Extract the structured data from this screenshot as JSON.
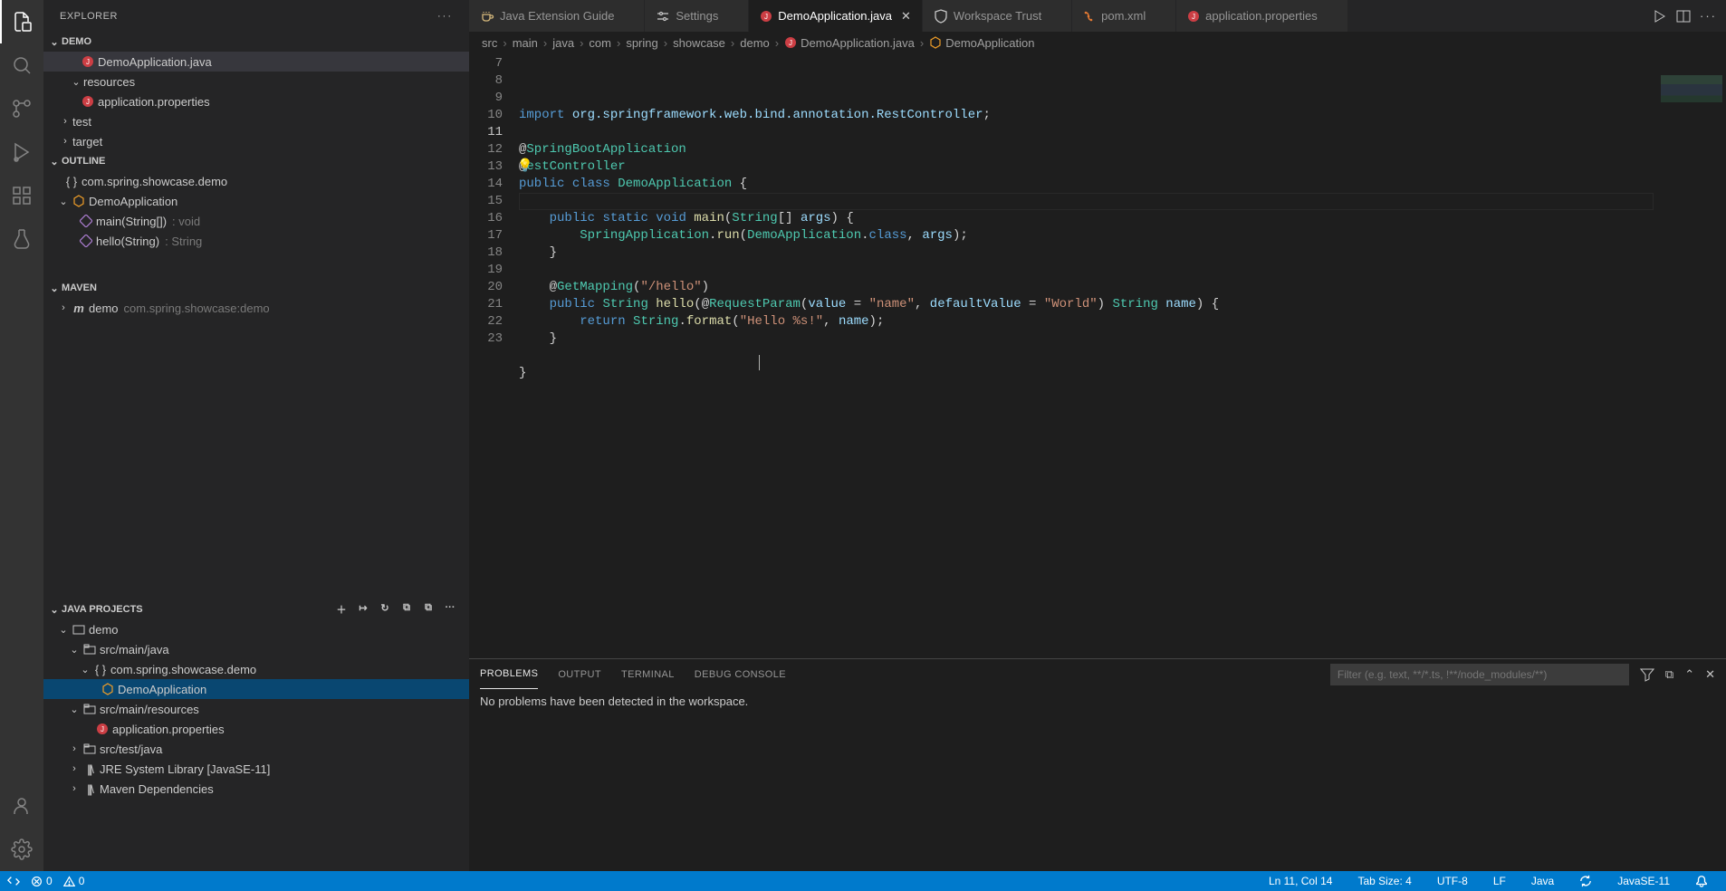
{
  "sidebar": {
    "title": "EXPLORER",
    "demo": {
      "title": "DEMO",
      "items": [
        "DemoApplication.java",
        "resources",
        "application.properties",
        "test",
        "target"
      ]
    },
    "outline": {
      "title": "OUTLINE",
      "ns": "com.spring.showcase.demo",
      "cls": "DemoApplication",
      "m1": "main(String[])",
      "m1d": ": void",
      "m2": "hello(String)",
      "m2d": ": String"
    },
    "maven": {
      "title": "MAVEN",
      "project": "demo",
      "detail": "com.spring.showcase:demo"
    },
    "javaprojects": {
      "title": "JAVA PROJECTS",
      "root": "demo",
      "srcmainjava": "src/main/java",
      "pkg": "com.spring.showcase.demo",
      "cls": "DemoApplication",
      "srcmainres": "src/main/resources",
      "appprops": "application.properties",
      "srctestjava": "src/test/java",
      "jre": "JRE System Library [JavaSE-11]",
      "mavendeps": "Maven Dependencies"
    }
  },
  "tabs": [
    {
      "label": "Java Extension Guide",
      "icon": "coffee"
    },
    {
      "label": "Settings",
      "icon": "settings"
    },
    {
      "label": "DemoApplication.java",
      "icon": "java",
      "active": true
    },
    {
      "label": "Workspace Trust",
      "icon": "shield"
    },
    {
      "label": "pom.xml",
      "icon": "xml"
    },
    {
      "label": "application.properties",
      "icon": "java"
    }
  ],
  "breadcrumb": [
    "src",
    "main",
    "java",
    "com",
    "spring",
    "showcase",
    "demo",
    "DemoApplication.java",
    "DemoApplication"
  ],
  "editor": {
    "first_line_no": 7,
    "lines": [
      {
        "no": 7,
        "html": "<span class='kw'>import</span> <span class='pkg'>org.springframework.web.bind.annotation.RestController</span>;"
      },
      {
        "no": 8,
        "html": ""
      },
      {
        "no": 9,
        "html": "<span class='pn'>@</span><span class='type'>SpringBootApplication</span>"
      },
      {
        "no": 10,
        "html": "<span class='bulb'>💡</span><span class='pn'>@</span><span class='type'>estController</span>",
        "overlay": "RestController"
      },
      {
        "no": 11,
        "html": "<span class='kw'>public</span> <span class='kw'>class</span> <span class='type'>DemoApplication</span> {",
        "active": true
      },
      {
        "no": 12,
        "html": ""
      },
      {
        "no": 13,
        "html": "    <span class='kw'>public</span> <span class='kw'>static</span> <span class='kw'>void</span> <span class='fn'>main</span>(<span class='type'>String</span>[] <span class='var'>args</span>) {"
      },
      {
        "no": 14,
        "html": "        <span class='type'>SpringApplication</span>.<span class='fn'>run</span>(<span class='type'>DemoApplication</span>.<span class='kw'>class</span>, <span class='var'>args</span>);"
      },
      {
        "no": 15,
        "html": "    }"
      },
      {
        "no": 16,
        "html": ""
      },
      {
        "no": 17,
        "html": "    <span class='pn'>@</span><span class='type'>GetMapping</span>(<span class='str'>\"/hello\"</span>)"
      },
      {
        "no": 18,
        "html": "    <span class='kw'>public</span> <span class='type'>String</span> <span class='fn'>hello</span>(<span class='pn'>@</span><span class='type'>RequestParam</span>(<span class='var'>value</span> = <span class='str'>\"name\"</span>, <span class='var'>defaultValue</span> = <span class='str'>\"World\"</span>) <span class='type'>String</span> <span class='var'>name</span>) {"
      },
      {
        "no": 19,
        "html": "        <span class='kw'>return</span> <span class='type'>String</span>.<span class='fn'>format</span>(<span class='str'>\"Hello %s!\"</span>, <span class='var'>name</span>);"
      },
      {
        "no": 20,
        "html": "    }"
      },
      {
        "no": 21,
        "html": ""
      },
      {
        "no": 22,
        "html": "}"
      },
      {
        "no": 23,
        "html": ""
      }
    ]
  },
  "panel": {
    "tabs": [
      "PROBLEMS",
      "OUTPUT",
      "TERMINAL",
      "DEBUG CONSOLE"
    ],
    "active": "PROBLEMS",
    "filter_placeholder": "Filter (e.g. text, **/*.ts, !**/node_modules/**)",
    "message": "No problems have been detected in the workspace."
  },
  "status": {
    "errors": "0",
    "warnings": "0",
    "ln_col": "Ln 11, Col 14",
    "tab_size": "Tab Size: 4",
    "encoding": "UTF-8",
    "eol": "LF",
    "language": "Java",
    "jre": "JavaSE-11"
  }
}
